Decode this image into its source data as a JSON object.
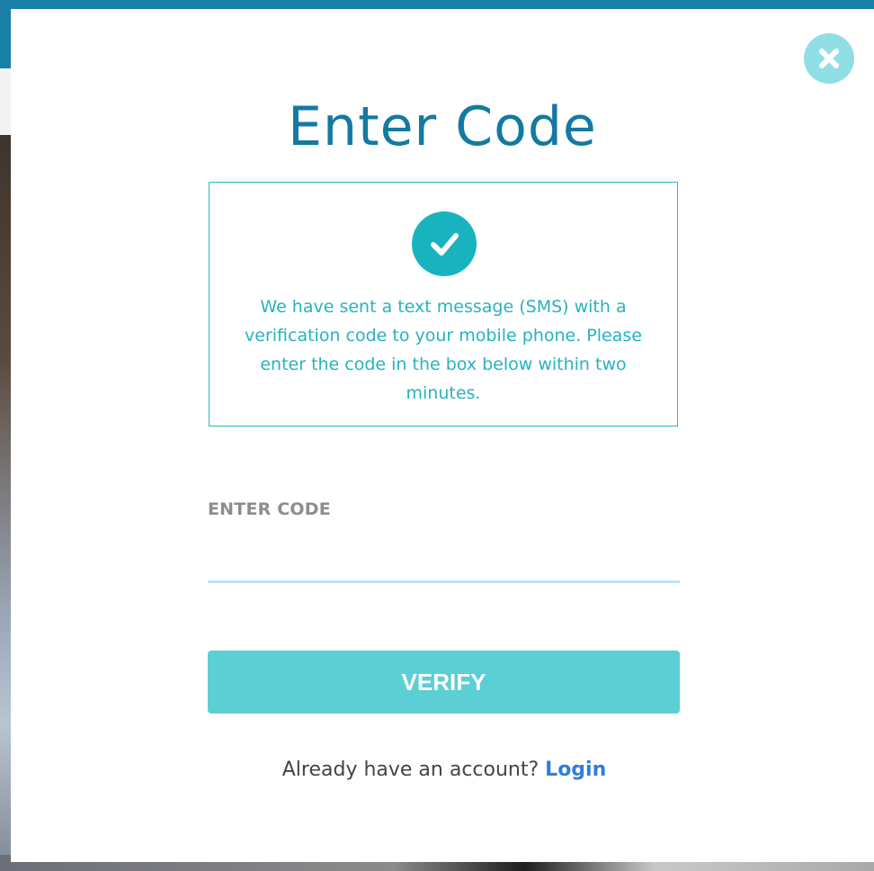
{
  "modal": {
    "title": "Enter Code",
    "close_icon": "close-icon",
    "info": {
      "icon": "check-circle-icon",
      "message": "We have sent a text message (SMS) with a verification code to your mobile phone. Please enter the code in the box below within two minutes."
    },
    "code_field": {
      "label": "ENTER CODE",
      "value": "",
      "placeholder": ""
    },
    "verify_label": "VERIFY",
    "login_prompt": "Already have an account?",
    "login_link": "Login"
  },
  "colors": {
    "title": "#137aa0",
    "accent": "#19b3bf",
    "button": "#5ccfd5",
    "link": "#2f7fd6",
    "close_circle": "#8fdfe4",
    "background_bar": "#1a7fa6"
  }
}
